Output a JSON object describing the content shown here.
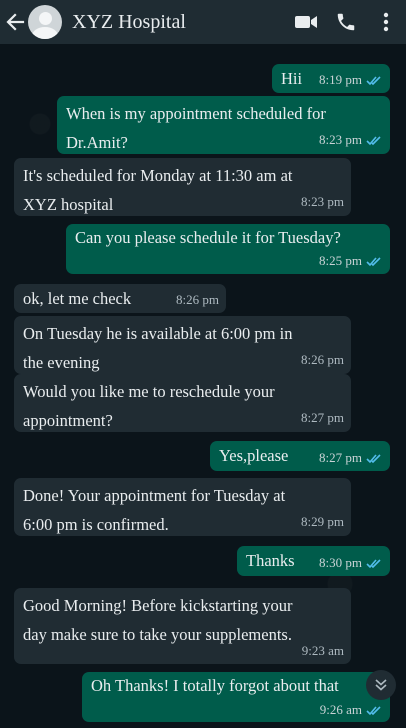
{
  "header": {
    "title": "XYZ Hospital",
    "icons": [
      "back-arrow-icon",
      "avatar",
      "video-call-icon",
      "phone-icon",
      "more-options-icon"
    ]
  },
  "colors": {
    "header": "#1f2c33",
    "background": "#0b141a",
    "outgoing": "#005c4b",
    "incoming": "#202c33",
    "read_tick": "#53bdeb"
  },
  "messages": [
    {
      "dir": "out",
      "text": "Hii",
      "time": "8:19 pm",
      "ticks": "read"
    },
    {
      "dir": "out",
      "lines": [
        "When is my appointment scheduled for",
        "Dr.Amit?"
      ],
      "time": "8:23 pm",
      "ticks": "read"
    },
    {
      "dir": "in",
      "lines": [
        "It's scheduled for Monday at 11:30 am at",
        "XYZ hospital"
      ],
      "time": "8:23 pm"
    },
    {
      "dir": "out",
      "text": "Can you please schedule it for Tuesday?",
      "time": "8:25 pm",
      "ticks": "read"
    },
    {
      "dir": "in",
      "text": "ok, let me check",
      "time": "8:26 pm"
    },
    {
      "dir": "in",
      "lines": [
        "On Tuesday he is available at 6:00 pm in",
        "the evening"
      ],
      "time": "8:26 pm"
    },
    {
      "dir": "in",
      "lines": [
        "Would you like me to reschedule your",
        "appointment?"
      ],
      "time": "8:27 pm"
    },
    {
      "dir": "out",
      "text": "Yes,please",
      "time": "8:27 pm",
      "ticks": "read"
    },
    {
      "dir": "in",
      "lines": [
        "Done! Your appointment for Tuesday at",
        "6:00 pm is confirmed."
      ],
      "time": "8:29 pm"
    },
    {
      "dir": "out",
      "text": "Thanks",
      "time": "8:30 pm",
      "ticks": "read"
    },
    {
      "dir": "in",
      "lines": [
        "Good Morning! Before kickstarting your",
        "day make sure to take your supplements."
      ],
      "time": "9:23 am"
    },
    {
      "dir": "out",
      "text": "Oh Thanks! I totally forgot about that",
      "time": "9:26 am",
      "ticks": "read"
    }
  ],
  "scroll_button_icon": "chevron-double-down-icon"
}
